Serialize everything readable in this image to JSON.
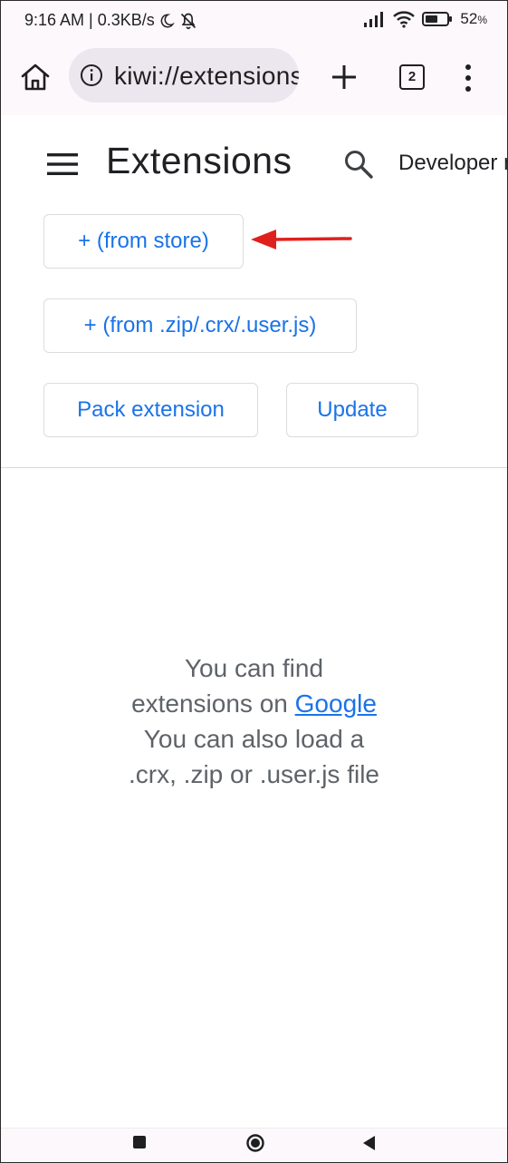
{
  "status_bar": {
    "time_speed": "9:16 AM | 0.3KB/s",
    "battery": "52",
    "battery_unit": "%"
  },
  "browser": {
    "url": "kiwi://extensions",
    "tab_count": "2"
  },
  "page": {
    "title": "Extensions",
    "developer_mode_label": "Developer mode"
  },
  "buttons": {
    "from_store": "+ (from store)",
    "from_file": "+ (from .zip/.crx/.user.js)",
    "pack": "Pack extension",
    "update": "Update"
  },
  "empty_state": {
    "line1_part1": "You can find",
    "line1_part2": "extensions on",
    "link": "Google",
    "line2": "You can also load a",
    "line3": ".crx, .zip or .user.js file"
  },
  "colors": {
    "accent": "#1a73e8",
    "arrow": "#e0201c",
    "chrome_bg": "#fcf8fb"
  },
  "icons": [
    "home-icon",
    "info-icon",
    "plus-icon",
    "tabs-icon",
    "overflow-menu-icon",
    "hamburger-menu-icon",
    "search-icon",
    "annotation-arrow",
    "recent-apps-icon",
    "nav-home-icon",
    "back-icon"
  ]
}
